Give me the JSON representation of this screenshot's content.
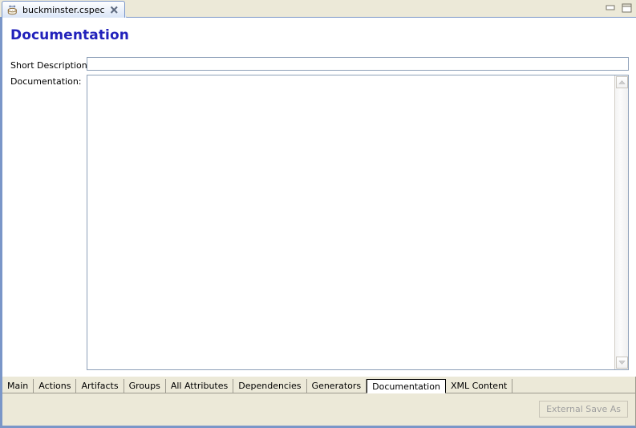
{
  "window": {
    "minimize_label": "Minimize",
    "maximize_label": "Maximize"
  },
  "editor_tab": {
    "label": "buckminster.cspec",
    "icon": "cspec-file-icon",
    "close_icon": "close-icon"
  },
  "page": {
    "title": "Documentation"
  },
  "fields": {
    "short_description": {
      "label": "Short Description:",
      "value": "",
      "placeholder": ""
    },
    "documentation": {
      "label": "Documentation:",
      "value": "",
      "placeholder": ""
    }
  },
  "scrollbar": {
    "up_icon": "scroll-up-arrow-icon",
    "down_icon": "scroll-down-arrow-icon"
  },
  "bottom_tabs": [
    {
      "label": "Main",
      "selected": false
    },
    {
      "label": "Actions",
      "selected": false
    },
    {
      "label": "Artifacts",
      "selected": false
    },
    {
      "label": "Groups",
      "selected": false
    },
    {
      "label": "All Attributes",
      "selected": false
    },
    {
      "label": "Dependencies",
      "selected": false
    },
    {
      "label": "Generators",
      "selected": false
    },
    {
      "label": "Documentation",
      "selected": true
    },
    {
      "label": "XML Content",
      "selected": false
    }
  ],
  "actions": {
    "external_save_as": "External Save As"
  },
  "colors": {
    "title_blue": "#2222bb",
    "chrome_beige": "#ece9d8",
    "accent_border": "#7a96c8"
  }
}
